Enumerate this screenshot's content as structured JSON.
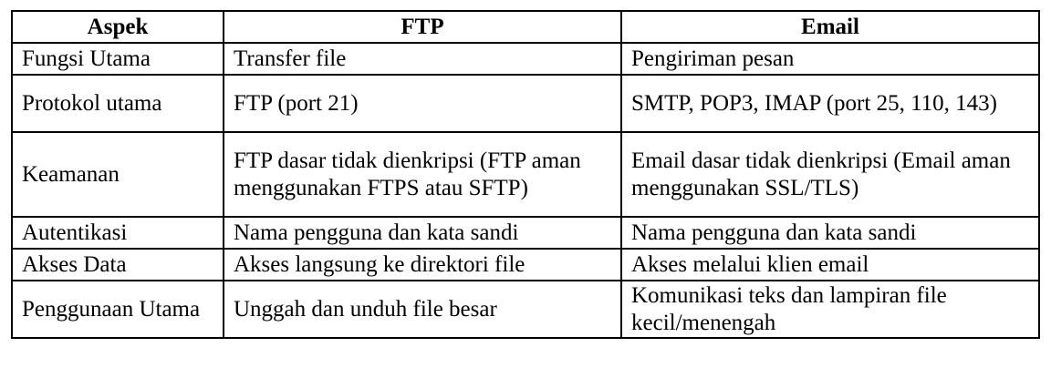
{
  "table": {
    "headers": [
      "Aspek",
      "FTP",
      "Email"
    ],
    "rows": [
      [
        "Fungsi Utama",
        "Transfer file",
        "Pengiriman pesan"
      ],
      [
        "Protokol utama",
        "FTP (port 21)",
        "SMTP, POP3, IMAP (port 25, 110, 143)"
      ],
      [
        "Keamanan",
        "FTP dasar tidak dienkripsi (FTP aman menggunakan FTPS atau SFTP)",
        "Email dasar tidak dienkripsi (Email aman menggunakan SSL/TLS)"
      ],
      [
        "Autentikasi",
        "Nama pengguna dan kata sandi",
        "Nama pengguna dan kata sandi"
      ],
      [
        "Akses Data",
        "Akses langsung ke direktori file",
        "Akses melalui klien email"
      ],
      [
        "Penggunaan Utama",
        "Unggah dan unduh file besar",
        "Komunikasi teks dan lampiran file kecil/menengah"
      ]
    ]
  }
}
